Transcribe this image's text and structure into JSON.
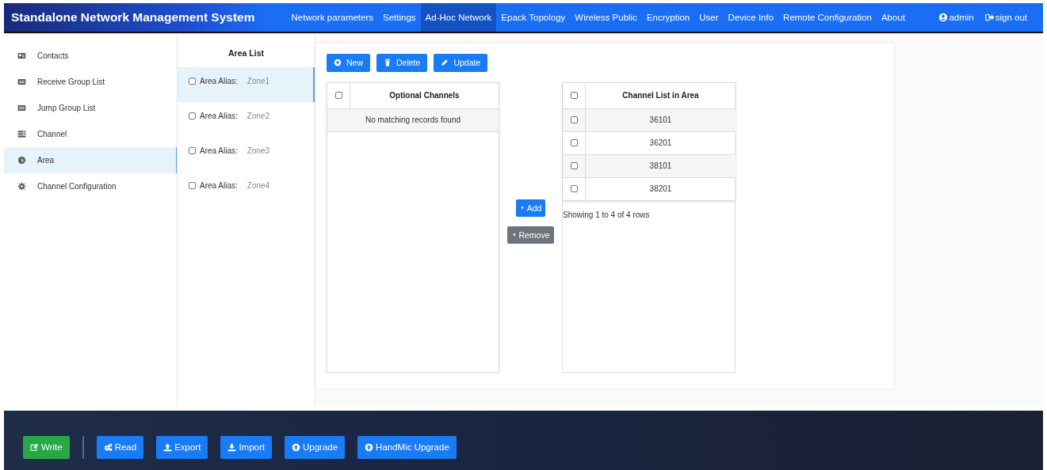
{
  "header": {
    "title": "Standalone Network Management System",
    "nav": [
      {
        "label": "Network parameters",
        "selected": false
      },
      {
        "label": "Settings",
        "selected": false
      },
      {
        "label": "Ad-Hoc Network",
        "selected": true
      },
      {
        "label": "Epack Topology",
        "selected": false
      },
      {
        "label": "Wireless Public",
        "selected": false
      },
      {
        "label": "Encryption",
        "selected": false
      },
      {
        "label": "User",
        "selected": false
      },
      {
        "label": "Device Info",
        "selected": false
      },
      {
        "label": "Remote Configuration",
        "selected": false
      },
      {
        "label": "About",
        "selected": false
      }
    ],
    "user": "admin",
    "sign_out": "sign out"
  },
  "sidebar": {
    "items": [
      {
        "label": "Contacts",
        "selected": false
      },
      {
        "label": "Receive Group List",
        "selected": false
      },
      {
        "label": "Jump Group List",
        "selected": false
      },
      {
        "label": "Channel",
        "selected": false
      },
      {
        "label": "Area",
        "selected": true
      },
      {
        "label": "Channel Configuration",
        "selected": false
      }
    ]
  },
  "area_list": {
    "title": "Area List",
    "items": [
      {
        "label": "Area Alias:",
        "value": "Zone1",
        "checked": false,
        "selected": true
      },
      {
        "label": "Area Alias:",
        "value": "Zone2",
        "checked": false,
        "selected": false
      },
      {
        "label": "Area Alias:",
        "value": "Zone3",
        "checked": false,
        "selected": false
      },
      {
        "label": "Area Alias:",
        "value": "Zone4",
        "checked": false,
        "selected": false
      }
    ]
  },
  "toolbar": [
    {
      "label": "New"
    },
    {
      "label": "Delete"
    },
    {
      "label": "Update"
    }
  ],
  "optional_channels": {
    "header": "Optional Channels",
    "header_checked": false,
    "empty": "No matching records found"
  },
  "transfer": [
    {
      "label": "Add",
      "kind": "primary"
    },
    {
      "label": "Remove",
      "kind": "secondary"
    }
  ],
  "area_channels": {
    "header": "Channel List in Area",
    "header_checked": false,
    "rows": [
      {
        "value": "36101",
        "checked": false
      },
      {
        "value": "36201",
        "checked": false
      },
      {
        "value": "38101",
        "checked": false
      },
      {
        "value": "38201",
        "checked": false
      }
    ],
    "footer": "Showing 1 to 4 of 4 rows"
  },
  "footer_buttons": [
    {
      "label": "Write",
      "kind": "success"
    },
    {
      "label": "Read",
      "kind": "primary"
    },
    {
      "label": "Export",
      "kind": "primary"
    },
    {
      "label": "Import",
      "kind": "primary"
    },
    {
      "label": "Upgrade",
      "kind": "primary"
    },
    {
      "label": "HandMic Upgrade",
      "kind": "primary"
    }
  ]
}
